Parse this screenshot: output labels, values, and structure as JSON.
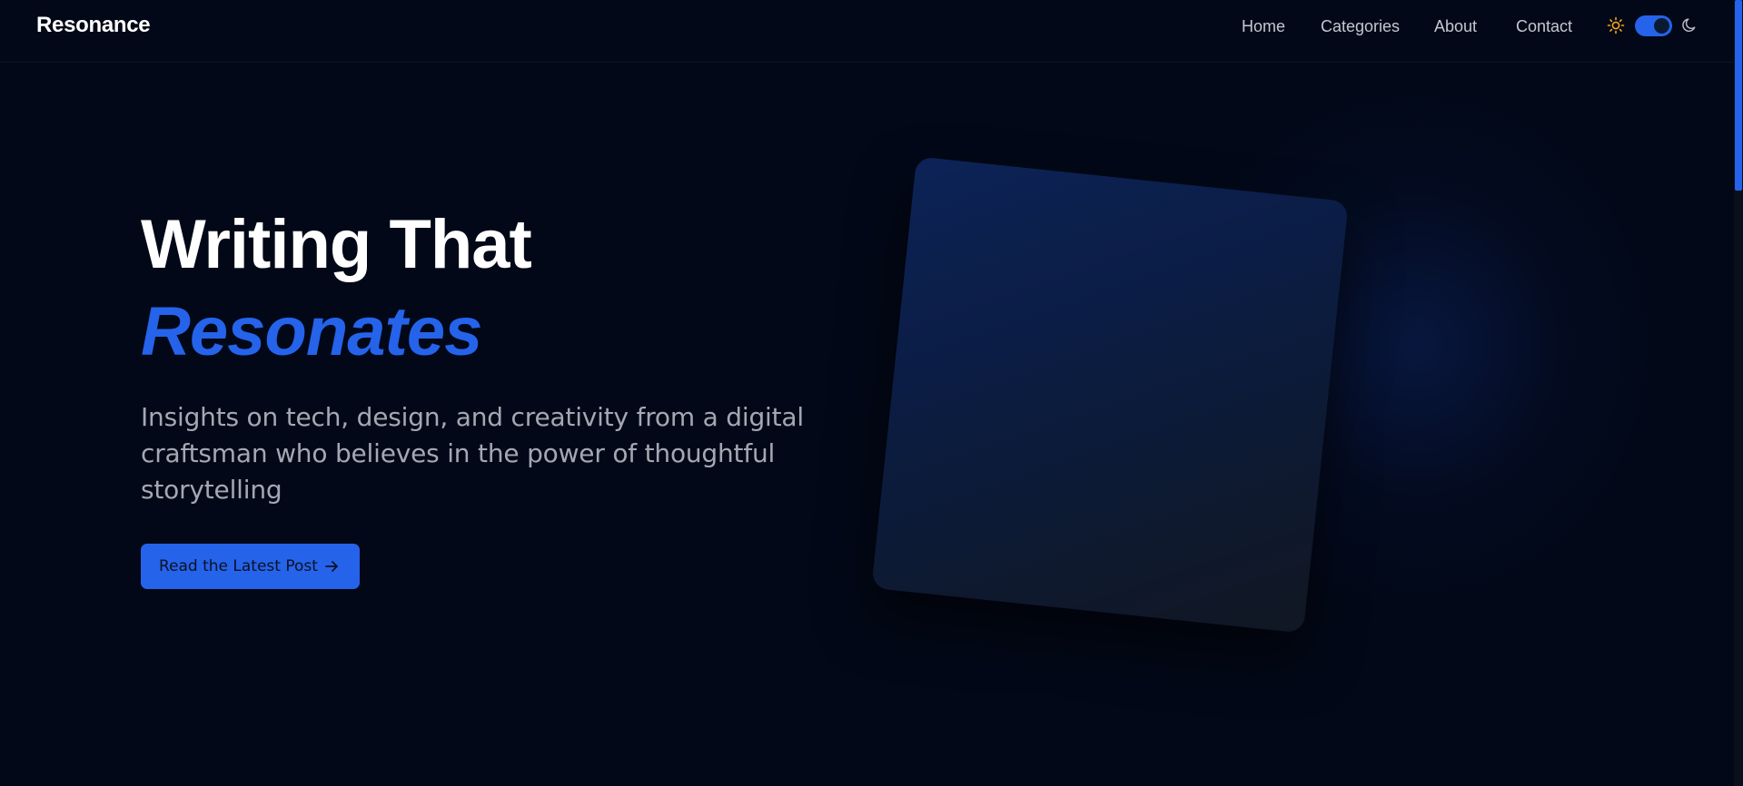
{
  "brand": {
    "name": "Resonance"
  },
  "nav": {
    "links": [
      "Home",
      "Categories",
      "About",
      "Contact"
    ]
  },
  "theme_toggle": {
    "light_icon": "sun-icon",
    "dark_icon": "moon-icon",
    "state": "dark",
    "accent_color": "#2563eb"
  },
  "hero": {
    "title_line1": "Writing That",
    "title_line2": "Resonates",
    "subtitle": "Insights on tech, design, and creativity from a digital craftsman who believes in the power of thoughtful storytelling",
    "cta_label": "Read the Latest Post",
    "cta_icon": "arrow-right-icon"
  },
  "colors": {
    "background": "#020817",
    "accent": "#2563eb",
    "muted_text": "#a3a8b2"
  }
}
